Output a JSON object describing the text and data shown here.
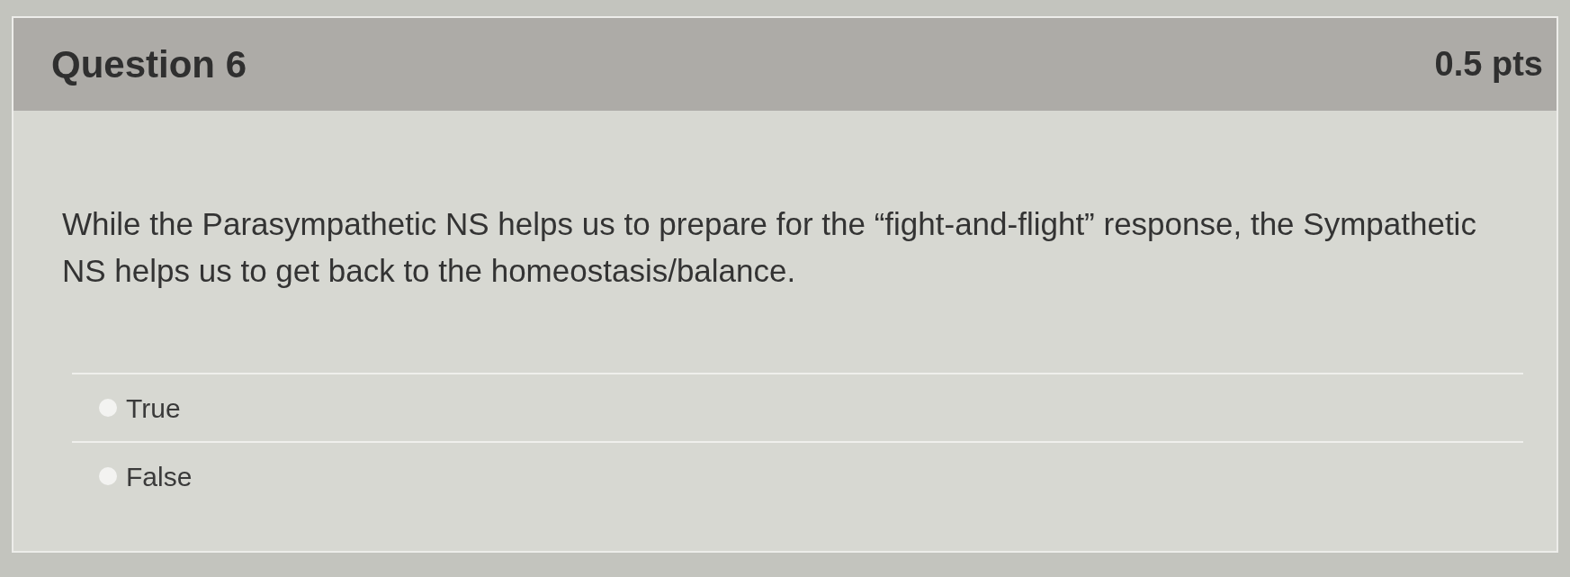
{
  "question": {
    "title": "Question 6",
    "points": "0.5 pts",
    "text": "While the Parasympathetic NS helps us to prepare for the “fight-and-flight” response, the Sympathetic NS helps us to get back to the homeostasis/balance."
  },
  "answers": [
    {
      "label": "True",
      "selected": false
    },
    {
      "label": "False",
      "selected": false
    }
  ]
}
